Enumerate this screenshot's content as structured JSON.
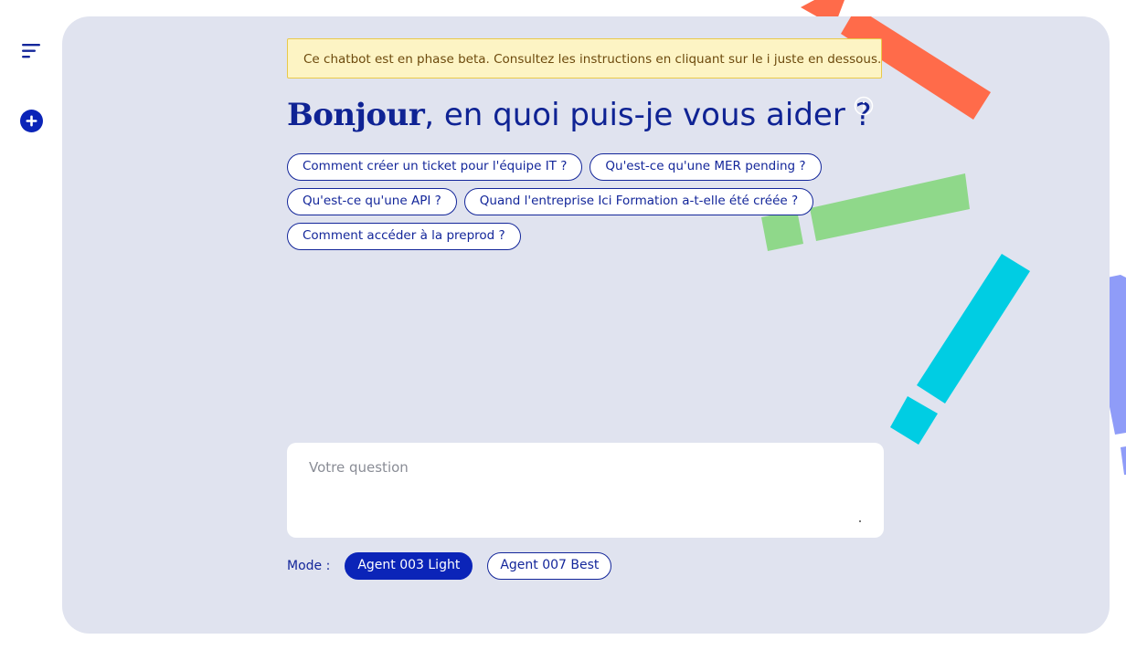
{
  "sidebar": {
    "menu_icon": "menu-lines-icon",
    "new_chat_icon": "plus-circle-icon"
  },
  "banner": {
    "text": "Ce chatbot est en phase beta. Consultez les instructions en cliquant sur le i juste en dessous."
  },
  "heading": {
    "bold": "Bonjour",
    "rest": ", en quoi puis-je vous aider ?"
  },
  "info_icon": "info-icon",
  "suggestions": [
    [
      "Comment créer un ticket pour l'équipe IT ?",
      "Qu'est-ce qu'une MER pending ?"
    ],
    [
      "Qu'est-ce qu'une API ?",
      "Quand l'entreprise Ici Formation a-t-elle été créée ?"
    ],
    [
      "Comment accéder à la preprod ?"
    ]
  ],
  "question": {
    "placeholder": "Votre question",
    "value": ""
  },
  "mode": {
    "label": "Mode :",
    "options": [
      "Agent 003 Light",
      "Agent 007 Best"
    ],
    "selected": "Agent 003 Light"
  },
  "colors": {
    "panel": "#e0e3ef",
    "primary": "#13269a",
    "active_chip": "#0b24b8",
    "deco_orange": "#ff6b4a",
    "deco_green": "#8fd88a",
    "deco_cyan": "#00cde3",
    "deco_periwinkle": "#8f9cf8"
  }
}
